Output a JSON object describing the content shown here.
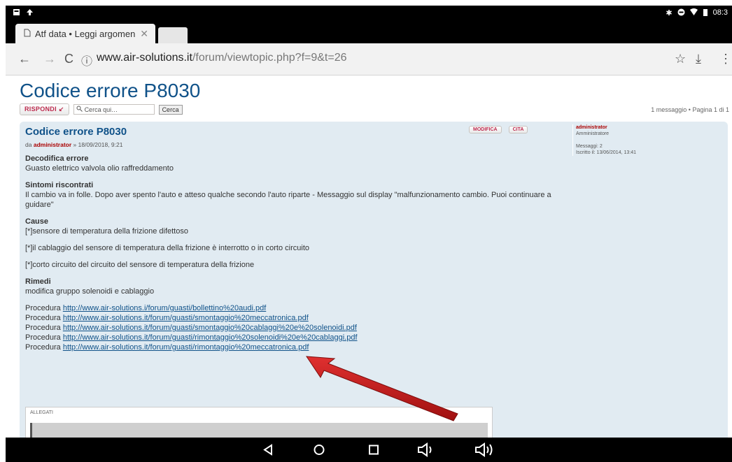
{
  "status_bar": {
    "time": "08:3"
  },
  "browser": {
    "tab_title": "Atf data • Leggi argomen",
    "url_host": "www.air-solutions.it",
    "url_path": "/forum/viewtopic.php?f=9&t=26"
  },
  "page": {
    "title": "Codice errore P8030",
    "reply_label": "RISPONDI",
    "search_placeholder": "Cerca qui…",
    "search_button": "Cerca",
    "pagination": "1 messaggio • Pagina 1 di 1"
  },
  "post": {
    "title": "Codice errore P8030",
    "meta_prefix": "da",
    "author": "administrator",
    "meta_date": "» 18/09/2018, 9:21",
    "edit_label": "MODIFICA",
    "quote_label": "CITA",
    "profile": {
      "username": "administrator",
      "role": "Amministratore",
      "messages": "Messaggi: 2",
      "registered": "Iscritto il: 13/06/2014, 13:41"
    },
    "sections": [
      {
        "heading": "Decodifica errore",
        "text": "Guasto elettrico valvola olio raffreddamento"
      },
      {
        "heading": "Sintomi riscontrati",
        "text": "Il cambio va in folle. Dopo aver spento l'auto e atteso qualche secondo l'auto riparte - Messaggio sul display \"malfunzionamento cambio. Puoi continuare a guidare\""
      }
    ],
    "cause_heading": "Cause",
    "causes": [
      "[*]sensore di temperatura della frizione difettoso",
      "[*]il cablaggio del sensore di temperatura della frizione è interrotto o in corto circuito",
      "[*]corto circuito del circuito del sensore di temperatura della frizione"
    ],
    "remedy_heading": "Rimedi",
    "remedy_text": "modifica gruppo solenoidi e cablaggio",
    "procedure_label": "Procedura",
    "procedures": [
      "http://www.air-solutions.i/forum/guasti/bollettino%20audi.pdf",
      "http://www.air-solutions.it/forum/guasti/smontaggio%20meccatronica.pdf",
      "http://www.air-solutions.it/forum/guasti/smontaggio%20cablaggi%20e%20solenoidi.pdf",
      "http://www.air-solutions.it/forum/guasti/rimontaggio%20solenoidi%20e%20cablaggi.pdf",
      "http://www.air-solutions.it/forum/guasti/rimontaggio%20meccatronica.pdf"
    ],
    "attachments_label": "ALLEGATI"
  },
  "colors": {
    "link": "#105289",
    "accent_red": "#aa0000",
    "post_bg": "#e1ebf2",
    "arrow": "#c41a1a"
  }
}
